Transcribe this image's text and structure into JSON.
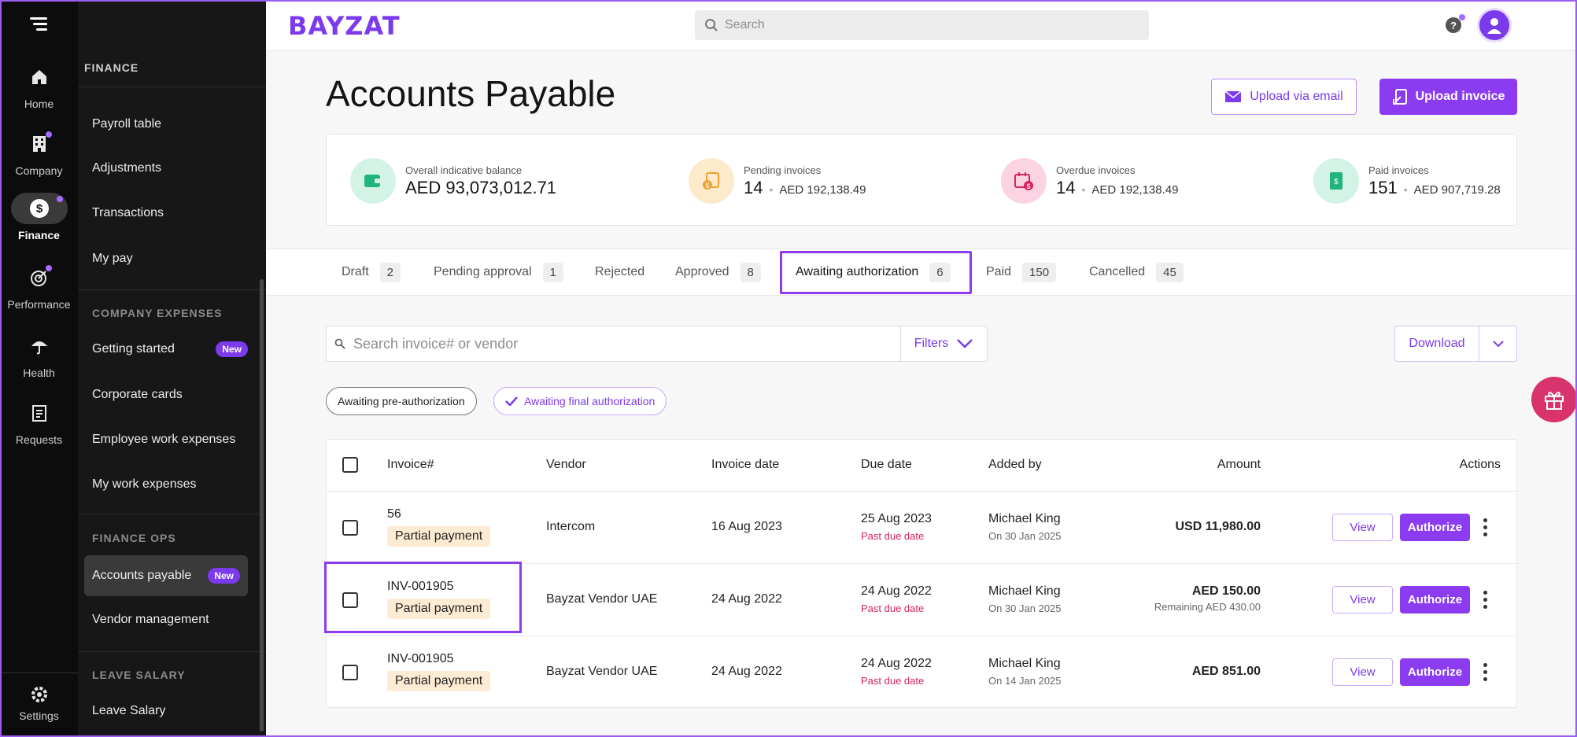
{
  "rail": {
    "items": [
      {
        "label": "Home",
        "icon": "home-icon"
      },
      {
        "label": "Company",
        "icon": "building-icon"
      },
      {
        "label": "Finance",
        "icon": "dollar-icon"
      },
      {
        "label": "Performance",
        "icon": "target-icon"
      },
      {
        "label": "Health",
        "icon": "umbrella-icon"
      },
      {
        "label": "Requests",
        "icon": "clipboard-icon"
      }
    ],
    "settings": "Settings"
  },
  "sidebar": {
    "heading": "FINANCE",
    "finance_items": [
      "Payroll table",
      "Adjustments",
      "Transactions",
      "My pay"
    ],
    "company_expenses_heading": "COMPANY EXPENSES",
    "company_expenses_items": [
      "Getting started",
      "Corporate cards",
      "Employee work expenses",
      "My work expenses"
    ],
    "finance_ops_heading": "FINANCE OPS",
    "finance_ops_items": [
      "Accounts payable",
      "Vendor management"
    ],
    "leave_salary_heading": "LEAVE SALARY",
    "leave_salary_items": [
      "Leave Salary"
    ],
    "new_badge": "New"
  },
  "topbar": {
    "brand": "BAYZAT",
    "search_placeholder": "Search",
    "help": "?"
  },
  "header": {
    "title": "Accounts Payable",
    "upload_email": "Upload via email",
    "upload_invoice": "Upload invoice"
  },
  "stats": [
    {
      "label": "Overall indicative balance",
      "value": "AED 93,073,012.71"
    },
    {
      "label": "Pending invoices",
      "count": "14",
      "amount": "AED 192,138.49"
    },
    {
      "label": "Overdue invoices",
      "count": "14",
      "amount": "AED 192,138.49"
    },
    {
      "label": "Paid invoices",
      "count": "151",
      "amount": "AED 907,719.28"
    }
  ],
  "tabs": [
    {
      "label": "Draft",
      "count": "2"
    },
    {
      "label": "Pending approval",
      "count": "1"
    },
    {
      "label": "Rejected",
      "count": ""
    },
    {
      "label": "Approved",
      "count": "8"
    },
    {
      "label": "Awaiting authorization",
      "count": "6"
    },
    {
      "label": "Paid",
      "count": "150"
    },
    {
      "label": "Cancelled",
      "count": "45"
    }
  ],
  "toolbar": {
    "search_placeholder": "Search invoice# or vendor",
    "filters": "Filters",
    "download": "Download"
  },
  "chips": [
    "Awaiting pre-authorization",
    "Awaiting final authorization"
  ],
  "table": {
    "headers": [
      "Invoice#",
      "Vendor",
      "Invoice date",
      "Due date",
      "Added by",
      "Amount",
      "Actions"
    ],
    "rows": [
      {
        "invoice": "56",
        "tag": "Partial payment",
        "vendor": "Intercom",
        "invoice_date": "16 Aug 2023",
        "due_date": "25 Aug 2023",
        "due_note": "Past due date",
        "added_by": "Michael King",
        "added_on": "On 30 Jan 2025",
        "amount": "USD 11,980.00",
        "remaining": ""
      },
      {
        "invoice": "INV-001905",
        "tag": "Partial payment",
        "vendor": "Bayzat Vendor UAE",
        "invoice_date": "24 Aug 2022",
        "due_date": "24 Aug 2022",
        "due_note": "Past due date",
        "added_by": "Michael King",
        "added_on": "On 30 Jan 2025",
        "amount": "AED 150.00",
        "remaining": "Remaining AED 430.00"
      },
      {
        "invoice": "INV-001905",
        "tag": "Partial payment",
        "vendor": "Bayzat Vendor UAE",
        "invoice_date": "24 Aug 2022",
        "due_date": "24 Aug 2022",
        "due_note": "Past due date",
        "added_by": "Michael King",
        "added_on": "On 14 Jan 2025",
        "amount": "AED 851.00",
        "remaining": ""
      }
    ],
    "view_label": "View",
    "authorize_label": "Authorize"
  },
  "colors": {
    "accent": "#8b3cf0",
    "danger": "#d6245c",
    "tag_bg": "#fdebd3"
  }
}
